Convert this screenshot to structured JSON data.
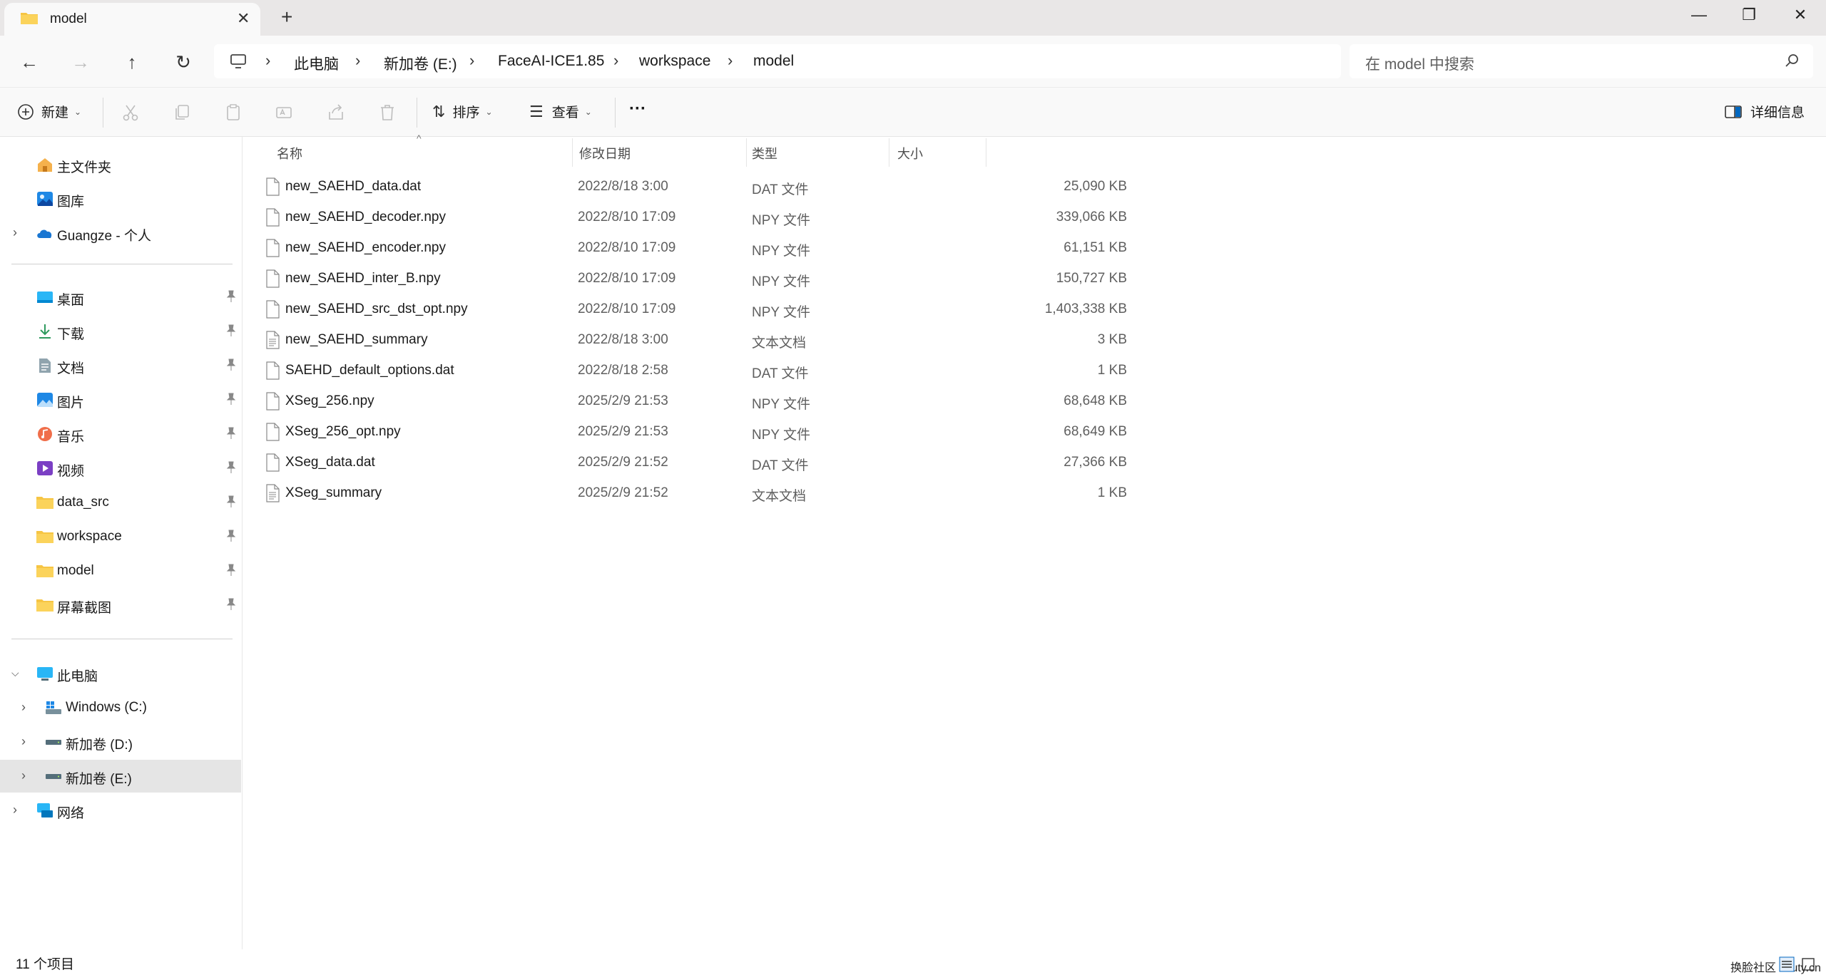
{
  "tab": {
    "title": "model",
    "new_tab": "+"
  },
  "window": {
    "minimize": "—",
    "restore": "❐",
    "close": "✕"
  },
  "breadcrumb": [
    "此电脑",
    "新加卷 (E:)",
    "FaceAI-ICE1.85",
    "workspace",
    "model"
  ],
  "search": {
    "placeholder": "在 model 中搜索"
  },
  "toolbar": {
    "new_label": "新建",
    "sort_label": "排序",
    "view_label": "查看",
    "more_label": "···",
    "details_label": "详细信息"
  },
  "sidebar": {
    "quick": [
      {
        "label": "主文件夹",
        "icon": "home-icon"
      },
      {
        "label": "图库",
        "icon": "gallery-icon"
      },
      {
        "label": "Guangze - 个人",
        "icon": "onedrive-cloud-icon"
      }
    ],
    "pinned": [
      {
        "label": "桌面",
        "icon": "desktop-icon"
      },
      {
        "label": "下载",
        "icon": "download-icon"
      },
      {
        "label": "文档",
        "icon": "documents-icon"
      },
      {
        "label": "图片",
        "icon": "pictures-icon"
      },
      {
        "label": "音乐",
        "icon": "music-icon"
      },
      {
        "label": "视频",
        "icon": "videos-icon"
      },
      {
        "label": "data_src",
        "icon": "folder-icon"
      },
      {
        "label": "workspace",
        "icon": "folder-icon"
      },
      {
        "label": "model",
        "icon": "folder-icon"
      },
      {
        "label": "屏幕截图",
        "icon": "folder-icon"
      }
    ],
    "this_pc": "此电脑",
    "drives": [
      {
        "label": "Windows (C:)",
        "icon": "windows-drive-icon"
      },
      {
        "label": "新加卷 (D:)",
        "icon": "drive-icon"
      },
      {
        "label": "新加卷 (E:)",
        "icon": "drive-icon",
        "selected": true
      }
    ],
    "network": "网络"
  },
  "columns": {
    "name": "名称",
    "date": "修改日期",
    "type": "类型",
    "size": "大小"
  },
  "files": [
    {
      "name": "new_SAEHD_data.dat",
      "date": "2022/8/18 3:00",
      "type": "DAT 文件",
      "size": "25,090 KB"
    },
    {
      "name": "new_SAEHD_decoder.npy",
      "date": "2022/8/10 17:09",
      "type": "NPY 文件",
      "size": "339,066 KB"
    },
    {
      "name": "new_SAEHD_encoder.npy",
      "date": "2022/8/10 17:09",
      "type": "NPY 文件",
      "size": "61,151 KB"
    },
    {
      "name": "new_SAEHD_inter_B.npy",
      "date": "2022/8/10 17:09",
      "type": "NPY 文件",
      "size": "150,727 KB"
    },
    {
      "name": "new_SAEHD_src_dst_opt.npy",
      "date": "2022/8/10 17:09",
      "type": "NPY 文件",
      "size": "1,403,338 KB"
    },
    {
      "name": "new_SAEHD_summary",
      "date": "2022/8/18 3:00",
      "type": "文本文档",
      "size": "3 KB"
    },
    {
      "name": "SAEHD_default_options.dat",
      "date": "2022/8/18 2:58",
      "type": "DAT 文件",
      "size": "1 KB"
    },
    {
      "name": "XSeg_256.npy",
      "date": "2025/2/9 21:53",
      "type": "NPY 文件",
      "size": "68,648 KB"
    },
    {
      "name": "XSeg_256_opt.npy",
      "date": "2025/2/9 21:53",
      "type": "NPY 文件",
      "size": "68,649 KB"
    },
    {
      "name": "XSeg_data.dat",
      "date": "2025/2/9 21:52",
      "type": "DAT 文件",
      "size": "27,366 KB"
    },
    {
      "name": "XSeg_summary",
      "date": "2025/2/9 21:52",
      "type": "文本文档",
      "size": "1 KB"
    }
  ],
  "status": {
    "count": "11 个项目",
    "watermark": "换脸社区 zhuty.cn"
  },
  "colors": {
    "folder": "#f6c544",
    "accent": "#0067c0",
    "selected": "#e5e5e5"
  }
}
